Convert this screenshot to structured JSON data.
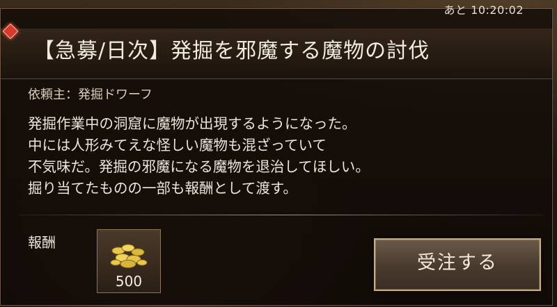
{
  "timer": "あと 10:20:02",
  "quest": {
    "title": "【急募/日次】発掘を邪魔する魔物の討伐",
    "client": "依頼主：発掘ドワーフ",
    "description": [
      "発掘作業中の洞窟に魔物が出現するようになった。",
      "中には人形みてえな怪しい魔物も混ざっていて",
      "不気味だ。発掘の邪魔になる魔物を退治してほしい。",
      "掘り当てたものの一部も報酬として渡す。"
    ]
  },
  "reward": {
    "label": "報酬",
    "item_icon": "gold-coins-icon",
    "count": "500"
  },
  "accept_button": "受注する",
  "colors": {
    "gem": "#d63a2a",
    "button_border": "#c7ad7c",
    "text": "#ece6da"
  }
}
